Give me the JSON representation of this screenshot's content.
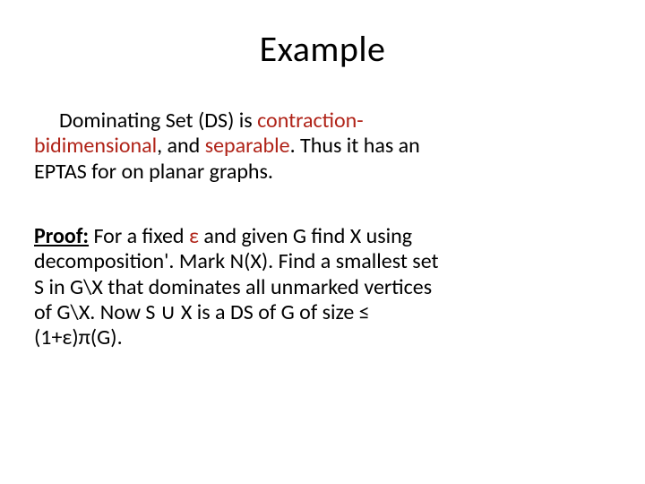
{
  "title": "Example",
  "para1": {
    "l1a": "Dominating Set (DS) is ",
    "l1b": "contraction-",
    "l2a": "bidimensional",
    "l2b": ", and ",
    "l2c": "separable",
    "l2d": ". Thus it has an",
    "l3": "EPTAS for on planar graphs."
  },
  "para2": {
    "label": "Proof:",
    "l1a": " For a fixed ",
    "l1b": "ε",
    "l1c": " and given G find X using",
    "l2": "decomposition'. Mark N(X). Find a smallest set",
    "l3": "S in G\\X that dominates all unmarked vertices",
    "l4a": "of G\\X. Now S",
    "l4b": " ∪ ",
    "l4c": "X is a DS of G of size ≤",
    "l5": "(1+ε)π(G)."
  }
}
